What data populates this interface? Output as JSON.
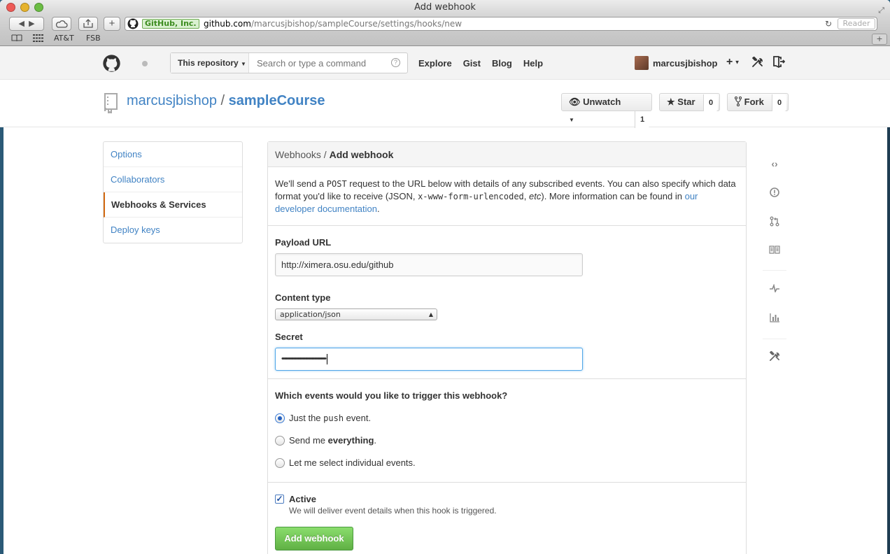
{
  "window": {
    "title": "Add webhook"
  },
  "browser": {
    "cert_label": "GitHub, Inc.",
    "url_host": "github.com",
    "url_path": "/marcusjbishop/sampleCourse/settings/hooks/new",
    "reader_label": "Reader",
    "bookmarks": [
      "AT&T",
      "FSB"
    ]
  },
  "gh_header": {
    "scope_label": "This repository",
    "search_placeholder": "Search or type a command",
    "nav": [
      "Explore",
      "Gist",
      "Blog",
      "Help"
    ],
    "username": "marcusjbishop",
    "plus": "+"
  },
  "repo": {
    "owner": "marcusjbishop",
    "separator": "/",
    "name": "sampleCourse",
    "unwatch_label": "Unwatch",
    "unwatch_count": "1",
    "star_label": "Star",
    "star_count": "0",
    "fork_label": "Fork",
    "fork_count": "0"
  },
  "menu": {
    "items": [
      "Options",
      "Collaborators",
      "Webhooks & Services",
      "Deploy keys"
    ]
  },
  "main": {
    "breadcrumb_parent": "Webhooks",
    "breadcrumb_sep": " / ",
    "breadcrumb_current": "Add webhook",
    "intro": {
      "t1": "We'll send a ",
      "code1": "POST",
      "t2": " request to the URL below with details of any subscribed events. You can also specify which data format you'd like to receive (JSON, ",
      "code2": "x-www-form-urlencoded",
      "t3": ", ",
      "em": "etc",
      "t4": "). More information can be found in ",
      "link": "our developer documentation",
      "t5": "."
    },
    "payload_label": "Payload URL",
    "payload_value": "http://ximera.osu.edu/github",
    "content_type_label": "Content type",
    "content_type_value": "application/json",
    "secret_label": "Secret",
    "secret_value": "••••••••••••••••••••••••••••••••••",
    "events_question": "Which events would you like to trigger this webhook?",
    "events": {
      "opt1_pre": "Just the ",
      "opt1_code": "push",
      "opt1_post": " event.",
      "opt2_pre": "Send me ",
      "opt2_bold": "everything",
      "opt2_post": ".",
      "opt3": "Let me select individual events."
    },
    "active_label": "Active",
    "active_note": "We will deliver event details when this hook is triggered.",
    "submit_label": "Add webhook"
  }
}
